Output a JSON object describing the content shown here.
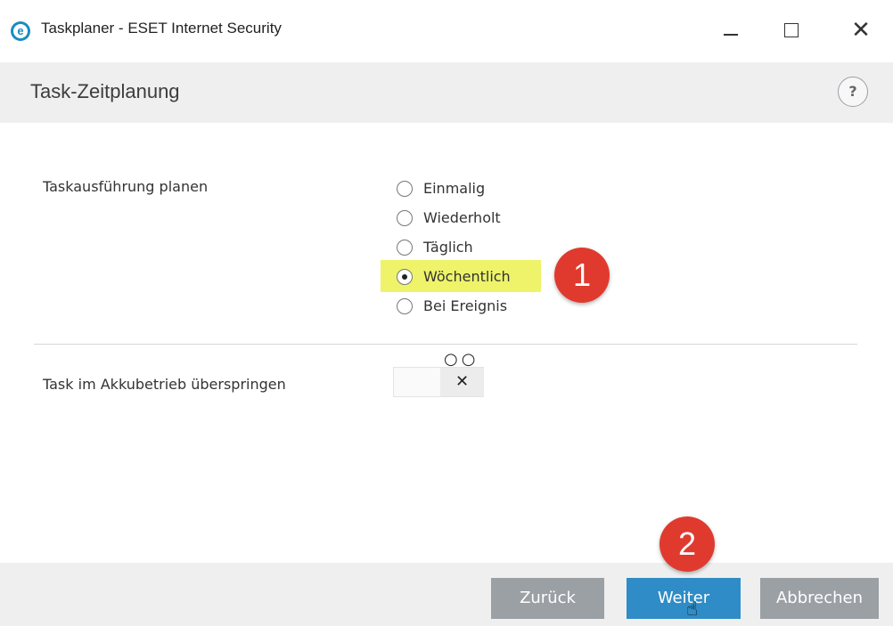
{
  "window": {
    "title": "Taskplaner - ESET Internet Security",
    "logo_letter": "e",
    "minimize_icon": "minimize-icon",
    "maximize_icon": "maximize-icon",
    "close_glyph": "✕"
  },
  "header": {
    "title": "Task-Zeitplanung",
    "help_glyph": "?"
  },
  "schedule": {
    "label": "Taskausführung planen",
    "options": [
      {
        "label": "Einmalig",
        "checked": false
      },
      {
        "label": "Wiederholt",
        "checked": false
      },
      {
        "label": "Täglich",
        "checked": false
      },
      {
        "label": "Wöchentlich",
        "checked": true
      },
      {
        "label": "Bei Ereignis",
        "checked": false
      }
    ],
    "highlight_color": "#eef36a"
  },
  "battery": {
    "label": "Task im Akkubetrieb überspringen",
    "toggle_glyph": "✕",
    "toggle_state": "off",
    "circles_glyph": "○○"
  },
  "annotations": {
    "badge_1": "1",
    "badge_2": "2",
    "badge_color": "#e03a2e"
  },
  "footer": {
    "back_label": "Zurück",
    "next_label": "Weiter",
    "cancel_label": "Abbrechen",
    "primary_color": "#2f8cc6",
    "secondary_color": "#9ba0a4"
  }
}
